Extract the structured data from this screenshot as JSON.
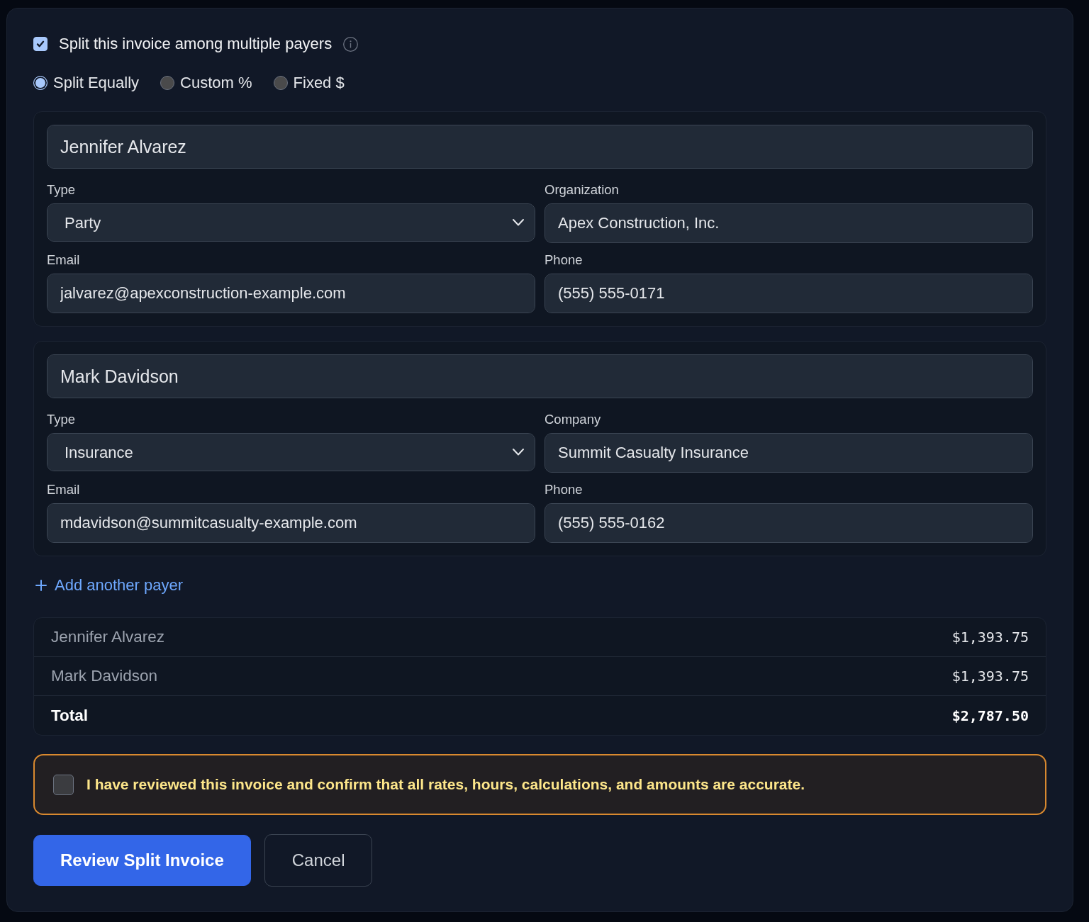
{
  "split_toggle": {
    "label": "Split this invoice among multiple payers",
    "checked": true
  },
  "split_methods": [
    {
      "label": "Split Equally",
      "selected": true
    },
    {
      "label": "Custom %",
      "selected": false
    },
    {
      "label": "Fixed $",
      "selected": false
    }
  ],
  "payers": [
    {
      "name": "Jennifer Alvarez",
      "fields": [
        {
          "kind": "select",
          "label": "Type",
          "value": "Party"
        },
        {
          "kind": "text",
          "label": "Organization",
          "value": "Apex Construction, Inc."
        },
        {
          "kind": "text",
          "label": "Email",
          "value": "jalvarez@apexconstruction-example.com"
        },
        {
          "kind": "text",
          "label": "Phone",
          "value": "(555) 555-0171"
        }
      ]
    },
    {
      "name": "Mark Davidson",
      "fields": [
        {
          "kind": "select",
          "label": "Type",
          "value": "Insurance"
        },
        {
          "kind": "text",
          "label": "Company",
          "value": "Summit Casualty Insurance"
        },
        {
          "kind": "text",
          "label": "Email",
          "value": "mdavidson@summitcasualty-example.com"
        },
        {
          "kind": "text",
          "label": "Phone",
          "value": "(555) 555-0162"
        }
      ]
    }
  ],
  "add_payer": {
    "label": "Add another payer"
  },
  "summary": {
    "rows": [
      {
        "kind": "payer",
        "name": "Jennifer Alvarez",
        "amount": "$1,393.75"
      },
      {
        "kind": "payer",
        "name": "Mark Davidson",
        "amount": "$1,393.75"
      },
      {
        "kind": "total",
        "name": "Total",
        "amount": "$2,787.50"
      }
    ]
  },
  "confirmation": {
    "label": "I have reviewed this invoice and confirm that all rates, hours, calculations, and amounts are accurate.",
    "checked": false
  },
  "buttons": [
    {
      "kind": "submit",
      "label": "Review Split Invoice"
    },
    {
      "kind": "cancel",
      "label": "Cancel"
    }
  ]
}
